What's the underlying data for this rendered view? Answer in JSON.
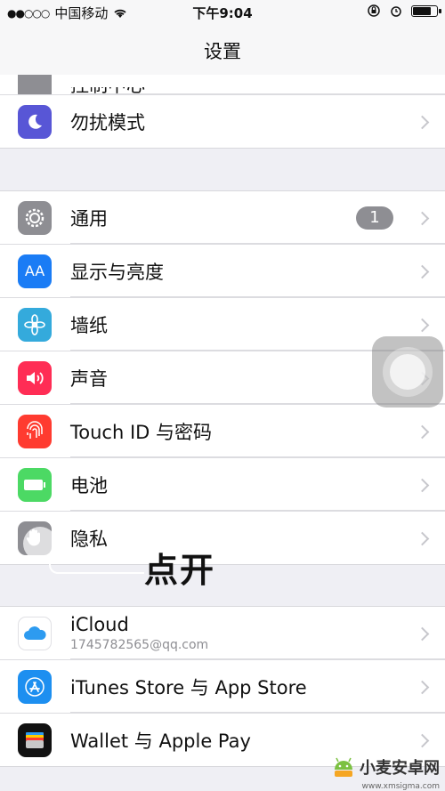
{
  "status_bar": {
    "signal": "●●○○○",
    "carrier": "中国移动",
    "time": "下午9:04"
  },
  "nav": {
    "title": "设置"
  },
  "top_group": {
    "partial_item": "控制中心",
    "items": [
      {
        "label": "勿扰模式",
        "icon": "moon-icon"
      }
    ]
  },
  "group2": {
    "items": [
      {
        "label": "通用",
        "icon": "gear-icon",
        "badge": "1"
      },
      {
        "label": "显示与亮度",
        "icon": "aa-text-icon",
        "icon_text": "AA"
      },
      {
        "label": "墙纸",
        "icon": "flower-icon"
      },
      {
        "label": "声音",
        "icon": "speaker-icon"
      },
      {
        "label": "Touch ID 与密码",
        "icon": "fingerprint-icon"
      },
      {
        "label": "电池",
        "icon": "battery-icon"
      },
      {
        "label": "隐私",
        "icon": "hand-icon"
      }
    ]
  },
  "group3": {
    "items": [
      {
        "label": "iCloud",
        "sublabel": "1745782565@qq.com",
        "icon": "cloud-icon"
      },
      {
        "label": "iTunes Store 与 App Store",
        "icon": "app-store-icon"
      },
      {
        "label": "Wallet 与 Apple Pay",
        "icon": "wallet-icon"
      }
    ]
  },
  "annotation": {
    "text": "点开"
  },
  "watermark": {
    "text": "小麦安卓网",
    "url": "www.xmsigma.com"
  },
  "colors": {
    "moon": "#5856d6",
    "gear": "#8e8e93",
    "display": "#1a7cf5",
    "wallpaper": "#34aadc",
    "sound": "#ff2d55",
    "touchid": "#ff3b30",
    "battery": "#4cd964",
    "privacy": "#8e8e93",
    "badge": "#8e8e93"
  }
}
